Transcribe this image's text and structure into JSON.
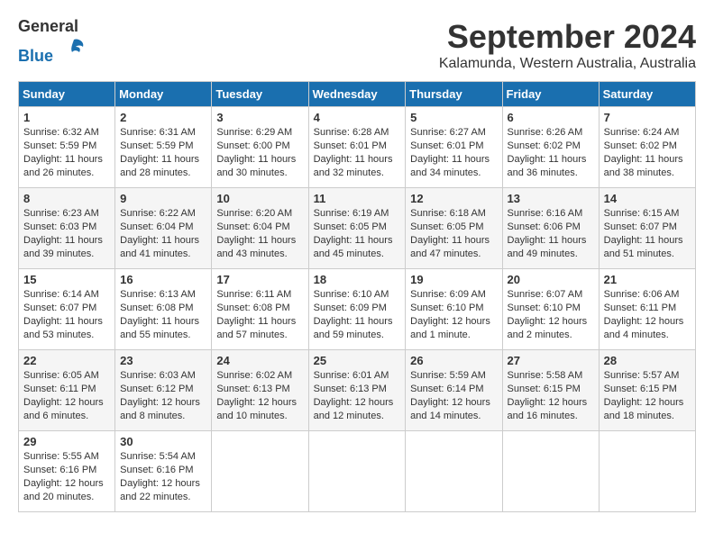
{
  "header": {
    "logo_general": "General",
    "logo_blue": "Blue",
    "month": "September 2024",
    "location": "Kalamunda, Western Australia, Australia"
  },
  "weekdays": [
    "Sunday",
    "Monday",
    "Tuesday",
    "Wednesday",
    "Thursday",
    "Friday",
    "Saturday"
  ],
  "weeks": [
    [
      {
        "day": 1,
        "sunrise": "6:32 AM",
        "sunset": "5:59 PM",
        "daylight": "11 hours and 26 minutes."
      },
      {
        "day": 2,
        "sunrise": "6:31 AM",
        "sunset": "5:59 PM",
        "daylight": "11 hours and 28 minutes."
      },
      {
        "day": 3,
        "sunrise": "6:29 AM",
        "sunset": "6:00 PM",
        "daylight": "11 hours and 30 minutes."
      },
      {
        "day": 4,
        "sunrise": "6:28 AM",
        "sunset": "6:01 PM",
        "daylight": "11 hours and 32 minutes."
      },
      {
        "day": 5,
        "sunrise": "6:27 AM",
        "sunset": "6:01 PM",
        "daylight": "11 hours and 34 minutes."
      },
      {
        "day": 6,
        "sunrise": "6:26 AM",
        "sunset": "6:02 PM",
        "daylight": "11 hours and 36 minutes."
      },
      {
        "day": 7,
        "sunrise": "6:24 AM",
        "sunset": "6:02 PM",
        "daylight": "11 hours and 38 minutes."
      }
    ],
    [
      {
        "day": 8,
        "sunrise": "6:23 AM",
        "sunset": "6:03 PM",
        "daylight": "11 hours and 39 minutes."
      },
      {
        "day": 9,
        "sunrise": "6:22 AM",
        "sunset": "6:04 PM",
        "daylight": "11 hours and 41 minutes."
      },
      {
        "day": 10,
        "sunrise": "6:20 AM",
        "sunset": "6:04 PM",
        "daylight": "11 hours and 43 minutes."
      },
      {
        "day": 11,
        "sunrise": "6:19 AM",
        "sunset": "6:05 PM",
        "daylight": "11 hours and 45 minutes."
      },
      {
        "day": 12,
        "sunrise": "6:18 AM",
        "sunset": "6:05 PM",
        "daylight": "11 hours and 47 minutes."
      },
      {
        "day": 13,
        "sunrise": "6:16 AM",
        "sunset": "6:06 PM",
        "daylight": "11 hours and 49 minutes."
      },
      {
        "day": 14,
        "sunrise": "6:15 AM",
        "sunset": "6:07 PM",
        "daylight": "11 hours and 51 minutes."
      }
    ],
    [
      {
        "day": 15,
        "sunrise": "6:14 AM",
        "sunset": "6:07 PM",
        "daylight": "11 hours and 53 minutes."
      },
      {
        "day": 16,
        "sunrise": "6:13 AM",
        "sunset": "6:08 PM",
        "daylight": "11 hours and 55 minutes."
      },
      {
        "day": 17,
        "sunrise": "6:11 AM",
        "sunset": "6:08 PM",
        "daylight": "11 hours and 57 minutes."
      },
      {
        "day": 18,
        "sunrise": "6:10 AM",
        "sunset": "6:09 PM",
        "daylight": "11 hours and 59 minutes."
      },
      {
        "day": 19,
        "sunrise": "6:09 AM",
        "sunset": "6:10 PM",
        "daylight": "12 hours and 1 minute."
      },
      {
        "day": 20,
        "sunrise": "6:07 AM",
        "sunset": "6:10 PM",
        "daylight": "12 hours and 2 minutes."
      },
      {
        "day": 21,
        "sunrise": "6:06 AM",
        "sunset": "6:11 PM",
        "daylight": "12 hours and 4 minutes."
      }
    ],
    [
      {
        "day": 22,
        "sunrise": "6:05 AM",
        "sunset": "6:11 PM",
        "daylight": "12 hours and 6 minutes."
      },
      {
        "day": 23,
        "sunrise": "6:03 AM",
        "sunset": "6:12 PM",
        "daylight": "12 hours and 8 minutes."
      },
      {
        "day": 24,
        "sunrise": "6:02 AM",
        "sunset": "6:13 PM",
        "daylight": "12 hours and 10 minutes."
      },
      {
        "day": 25,
        "sunrise": "6:01 AM",
        "sunset": "6:13 PM",
        "daylight": "12 hours and 12 minutes."
      },
      {
        "day": 26,
        "sunrise": "5:59 AM",
        "sunset": "6:14 PM",
        "daylight": "12 hours and 14 minutes."
      },
      {
        "day": 27,
        "sunrise": "5:58 AM",
        "sunset": "6:15 PM",
        "daylight": "12 hours and 16 minutes."
      },
      {
        "day": 28,
        "sunrise": "5:57 AM",
        "sunset": "6:15 PM",
        "daylight": "12 hours and 18 minutes."
      }
    ],
    [
      {
        "day": 29,
        "sunrise": "5:55 AM",
        "sunset": "6:16 PM",
        "daylight": "12 hours and 20 minutes."
      },
      {
        "day": 30,
        "sunrise": "5:54 AM",
        "sunset": "6:16 PM",
        "daylight": "12 hours and 22 minutes."
      },
      null,
      null,
      null,
      null,
      null
    ]
  ]
}
